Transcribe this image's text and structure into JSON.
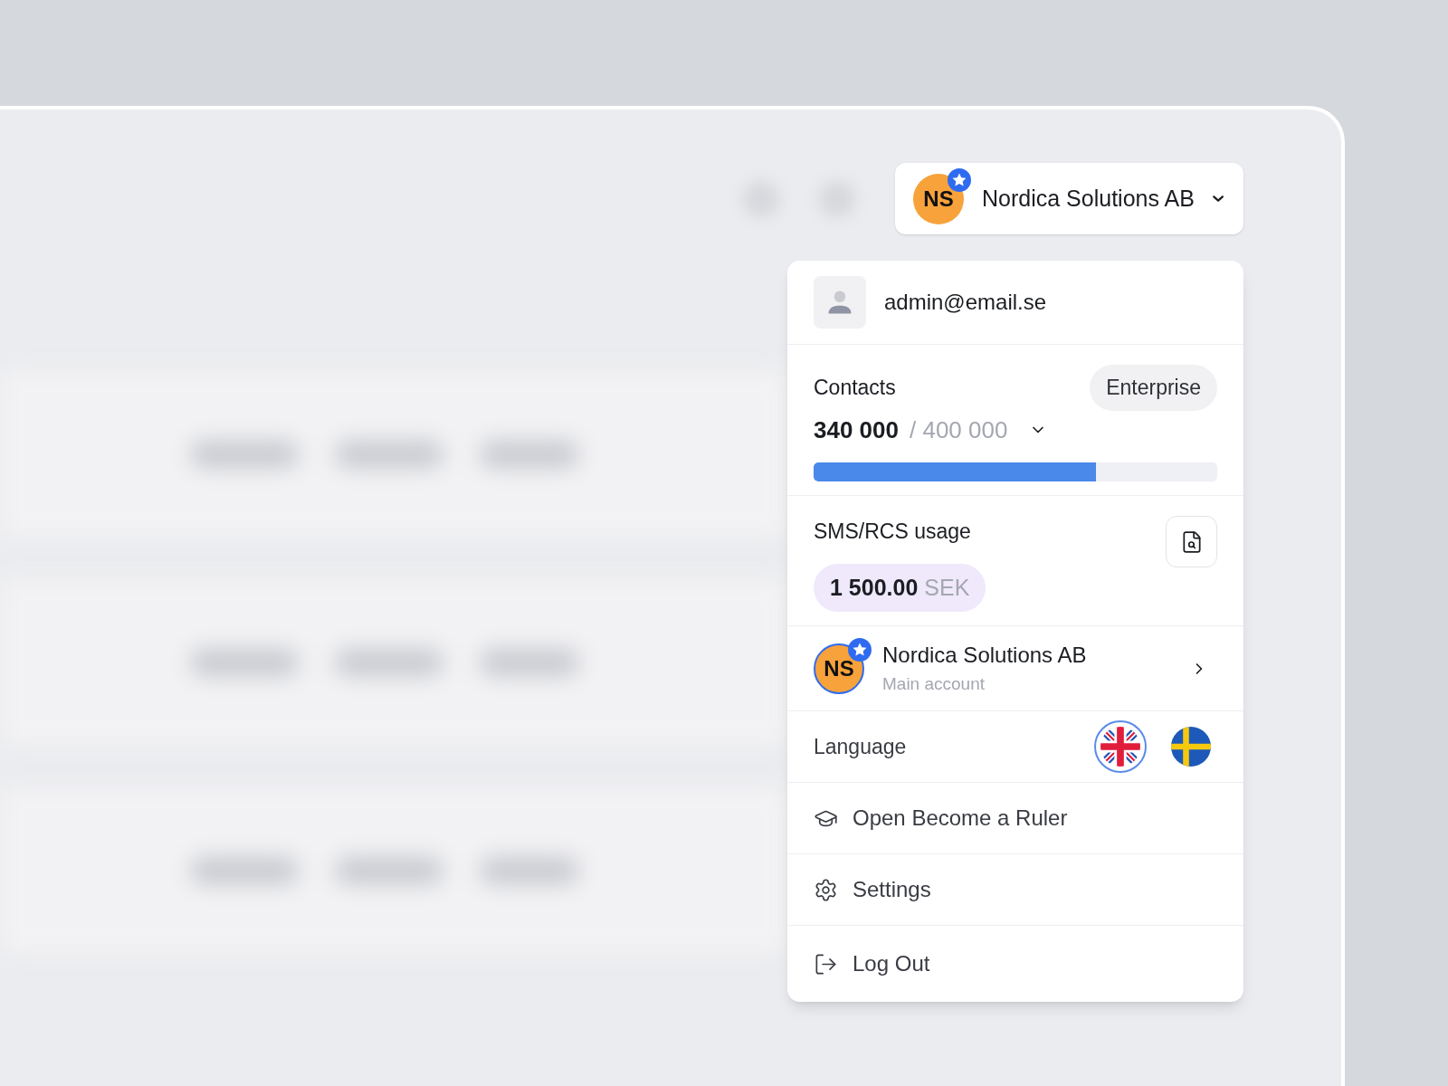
{
  "account_button": {
    "initials": "NS",
    "name": "Nordica Solutions AB",
    "starred": true
  },
  "menu": {
    "email": "admin@email.se",
    "contacts": {
      "label": "Contacts",
      "plan": "Enterprise",
      "used": "340 000",
      "limit": "/ 400 000",
      "level": 0.7
    },
    "usage": {
      "label": "SMS/RCS usage",
      "amount": "1 500.00",
      "currency": "SEK"
    },
    "account": {
      "initials": "NS",
      "name": "Nordica Solutions AB",
      "subtitle": "Main account",
      "starred": true
    },
    "language": {
      "label": "Language",
      "options": [
        {
          "kind": "uk",
          "selected": true
        },
        {
          "kind": "sweden",
          "selected": false
        }
      ]
    },
    "items": [
      {
        "kind": "course",
        "label": "Open Become a Ruler"
      },
      {
        "kind": "settings",
        "label": "Settings"
      },
      {
        "kind": "logout",
        "label": "Log Out"
      }
    ]
  }
}
